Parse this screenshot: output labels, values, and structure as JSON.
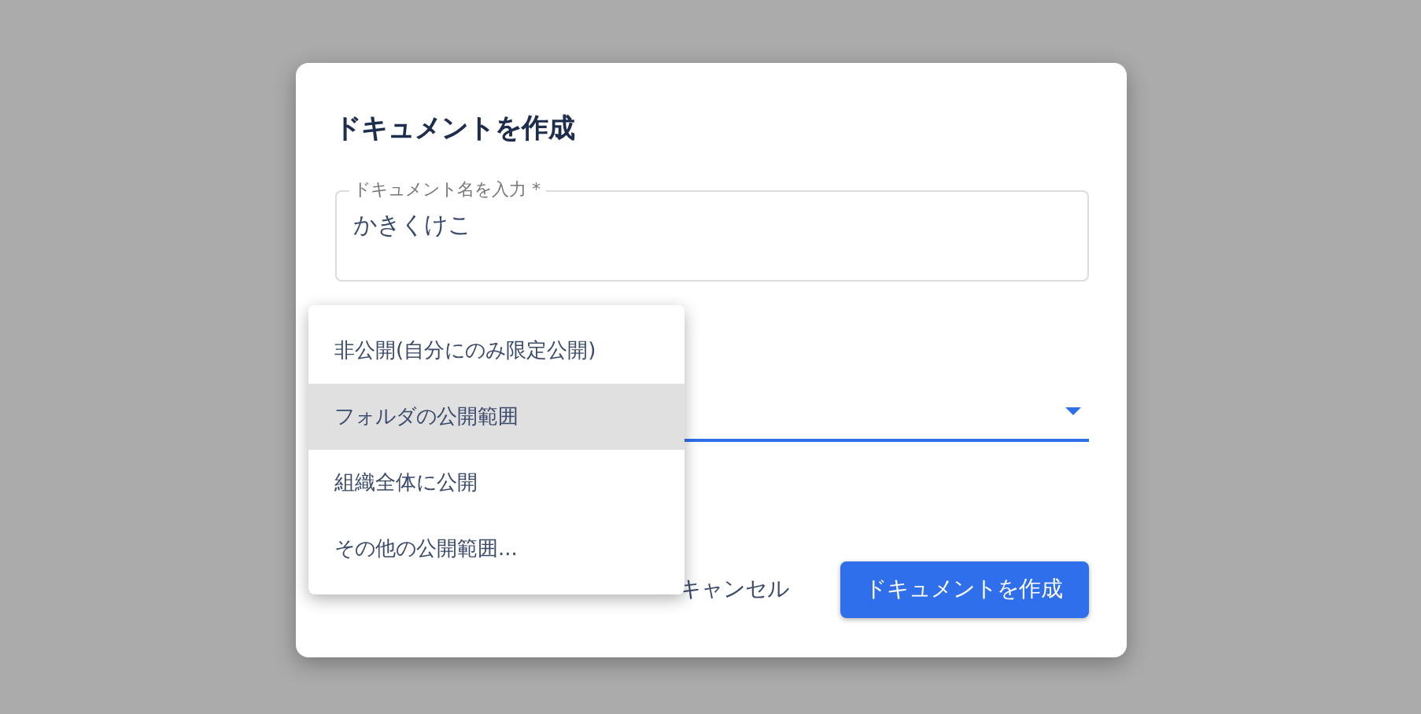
{
  "dialog": {
    "title": "ドキュメントを作成"
  },
  "name_field": {
    "label": "ドキュメント名を入力 *",
    "value": "かきくけこ"
  },
  "visibility_select": {
    "focused": true
  },
  "menu": {
    "items": [
      {
        "label": "非公開(自分にのみ限定公開)",
        "selected": false
      },
      {
        "label": "フォルダの公開範囲",
        "selected": true
      },
      {
        "label": "組織全体に公開",
        "selected": false
      },
      {
        "label": "その他の公開範囲...",
        "selected": false
      }
    ]
  },
  "buttons": [
    {
      "label": "キャンセル",
      "kind": "text"
    },
    {
      "label": "ドキュメントを作成",
      "kind": "primary"
    }
  ]
}
